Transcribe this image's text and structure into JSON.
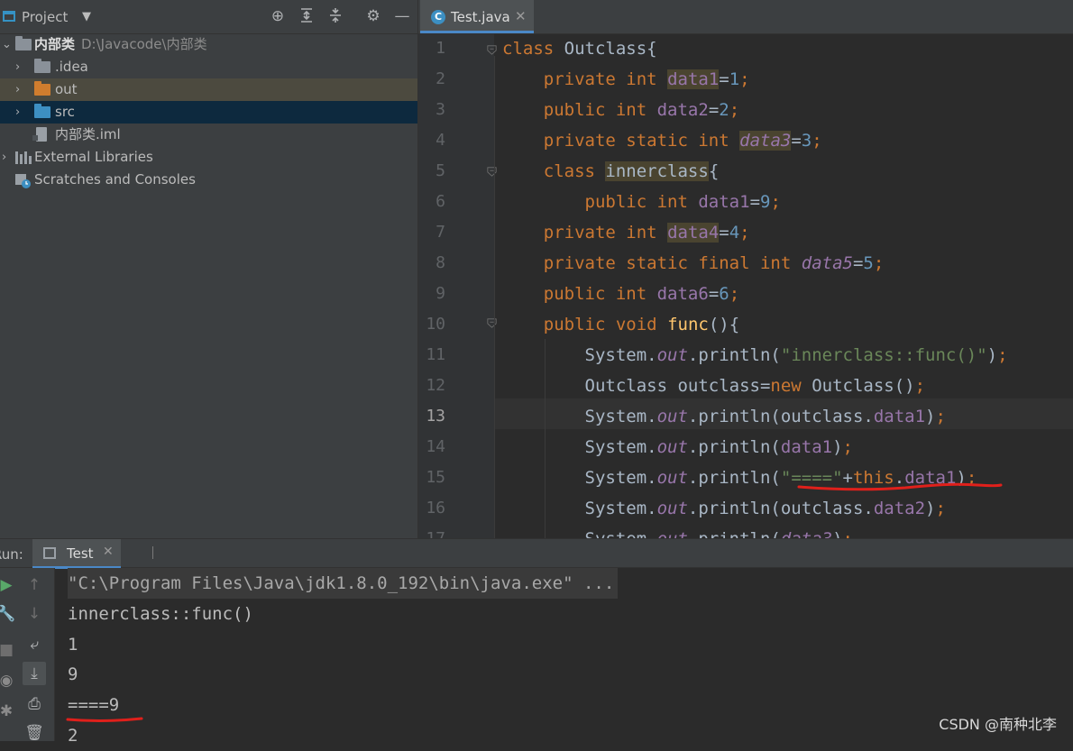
{
  "project": {
    "title": "Project",
    "tree": [
      {
        "label": "内部类",
        "path": "D:\\Javacode\\内部类"
      },
      {
        "label": ".idea"
      },
      {
        "label": "out"
      },
      {
        "label": "src"
      },
      {
        "label": "内部类.iml"
      },
      {
        "label": "External Libraries"
      },
      {
        "label": "Scratches and Consoles"
      }
    ]
  },
  "editor": {
    "tab_label": "Test.java",
    "line_numbers": [
      "1",
      "2",
      "3",
      "4",
      "5",
      "6",
      "7",
      "8",
      "9",
      "10",
      "11",
      "12",
      "13",
      "14",
      "15",
      "16",
      "17"
    ],
    "current_line": 13
  },
  "run": {
    "label": "Run:",
    "tab_label": "Test",
    "output": [
      "\"C:\\Program Files\\Java\\jdk1.8.0_192\\bin\\java.exe\" ...",
      "innerclass::func()",
      "1",
      "9",
      "====9",
      "2"
    ]
  },
  "watermark": "CSDN @南种北李",
  "colors": {
    "accent": "#4a88c7",
    "annotation_underline": "#e0201b",
    "keyword": "#cc7832",
    "field": "#9876aa",
    "number": "#6897bb",
    "string": "#6a8759"
  }
}
